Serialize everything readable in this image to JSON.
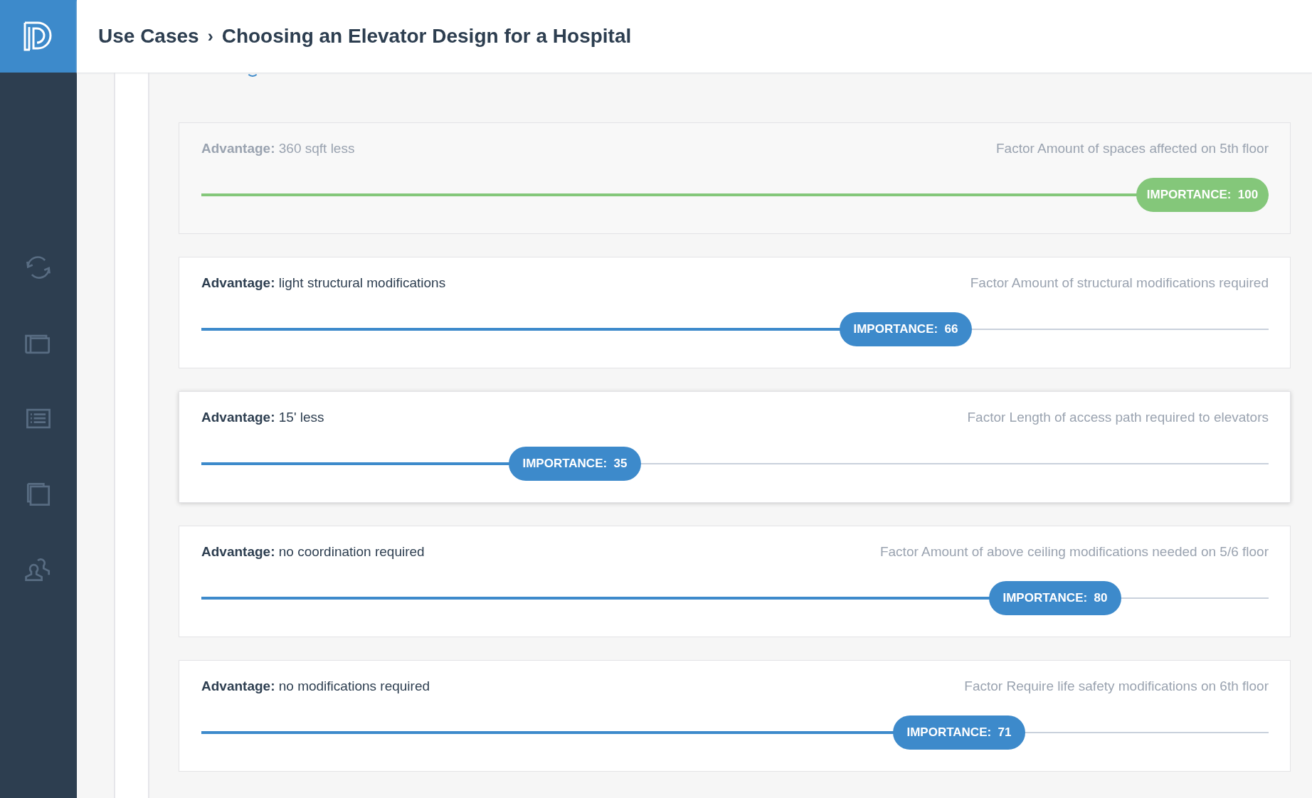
{
  "header": {
    "breadcrumb": [
      {
        "label": "Use Cases"
      },
      {
        "label": "Choosing an Elevator Design for a Hospital"
      }
    ],
    "separator": "›"
  },
  "sidebar": {
    "items": [
      {
        "kind": "sync"
      },
      {
        "kind": "folder"
      },
      {
        "kind": "list"
      },
      {
        "kind": "copy"
      },
      {
        "kind": "users"
      }
    ]
  },
  "factors": [
    {
      "advantage_label": "Advantage:",
      "advantage": "360 sqft less",
      "factor": "Factor Amount of spaces affected on 5th floor",
      "disabled": true,
      "highlighted": false,
      "color": "#84c77a",
      "level": 1.0,
      "importance": "IMPORTANCE:  100"
    },
    {
      "advantage_label": "Advantage:",
      "advantage": "light structural modifications",
      "factor": "Factor Amount of structural modifications required",
      "disabled": false,
      "highlighted": false,
      "color": "#3d8acb",
      "level": 0.66,
      "importance": "IMPORTANCE:  66"
    },
    {
      "advantage_label": "Advantage:",
      "advantage": "15' less",
      "factor": "Factor Length of access path required to elevators",
      "disabled": false,
      "highlighted": true,
      "color": "#3d8acb",
      "level": 0.35,
      "importance": "IMPORTANCE:  35"
    },
    {
      "advantage_label": "Advantage:",
      "advantage": "no coordination required",
      "factor": "Factor Amount of above ceiling modifications needed on 5/6 floor",
      "disabled": false,
      "highlighted": false,
      "color": "#3d8acb",
      "level": 0.8,
      "importance": "IMPORTANCE:  80"
    },
    {
      "advantage_label": "Advantage:",
      "advantage": "no modifications required",
      "factor": "Factor Require life safety modifications on 6th floor",
      "disabled": false,
      "highlighted": false,
      "color": "#3d8acb",
      "level": 0.71,
      "importance": "IMPORTANCE:  71"
    }
  ]
}
